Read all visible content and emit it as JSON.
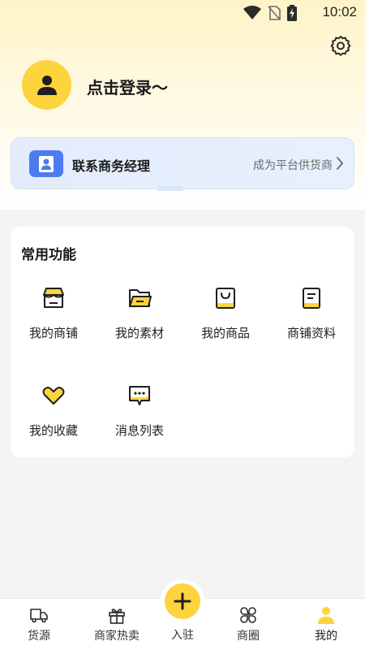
{
  "status_bar": {
    "time": "10:02",
    "icons": [
      "wifi-icon",
      "no-sim-icon",
      "battery-charging-icon"
    ]
  },
  "header": {
    "settings_icon": "gear-icon",
    "login_text": "点击登录～"
  },
  "contact_card": {
    "title": "联系商务经理",
    "action": "成为平台供货商"
  },
  "functions": {
    "title": "常用功能",
    "items": [
      {
        "label": "我的商铺",
        "icon": "shop-icon"
      },
      {
        "label": "我的素材",
        "icon": "folder-icon"
      },
      {
        "label": "我的商品",
        "icon": "shopping-bag-icon"
      },
      {
        "label": "商铺资料",
        "icon": "document-icon"
      },
      {
        "label": "我的收藏",
        "icon": "heart-icon"
      },
      {
        "label": "消息列表",
        "icon": "message-icon"
      }
    ]
  },
  "bottom_nav": {
    "items": [
      {
        "label": "货源",
        "icon": "truck-icon"
      },
      {
        "label": "商家热卖",
        "icon": "gift-icon"
      },
      {
        "label": "入驻",
        "icon": "plus-icon"
      },
      {
        "label": "商圈",
        "icon": "circles-icon"
      },
      {
        "label": "我的",
        "icon": "person-icon"
      }
    ],
    "active": "我的"
  },
  "colors": {
    "accent": "#fdd43d",
    "blue": "#4d7cf0"
  }
}
